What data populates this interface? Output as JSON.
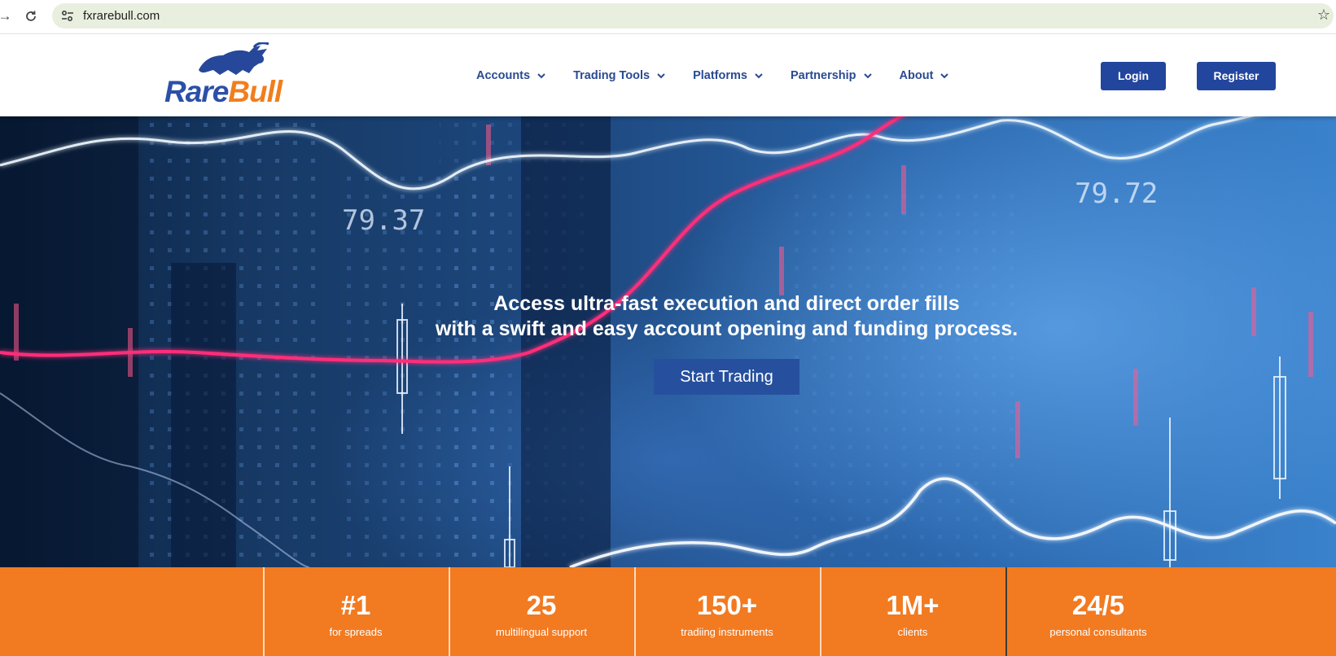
{
  "browser": {
    "url": "fxrarebull.com",
    "icons": [
      "back-arrow-icon",
      "reload-icon",
      "site-settings-icon",
      "bookmark-star-icon"
    ]
  },
  "header": {
    "logo": {
      "part1": "Rare",
      "part2": "Bull"
    },
    "nav": [
      {
        "label": "Accounts"
      },
      {
        "label": "Trading Tools"
      },
      {
        "label": "Platforms"
      },
      {
        "label": "Partnership"
      },
      {
        "label": "About"
      }
    ],
    "login_label": "Login",
    "register_label": "Register",
    "brand_color": "#22469d",
    "accent_color": "#f07e1e"
  },
  "hero": {
    "line1": "Access ultra-fast execution and direct order fills",
    "line2": "with a swift and easy account opening and funding process.",
    "cta_label": "Start Trading",
    "tickers": [
      "79.37",
      "79.72"
    ]
  },
  "stats": [
    {
      "value": "#1",
      "label": "for spreads"
    },
    {
      "value": "25",
      "label": "multilingual support"
    },
    {
      "value": "150+",
      "label": "tradiing instruments"
    },
    {
      "value": "1M+",
      "label": "clients"
    },
    {
      "value": "24/5",
      "label": "personal consultants"
    }
  ],
  "stats_color": "#f27a21"
}
